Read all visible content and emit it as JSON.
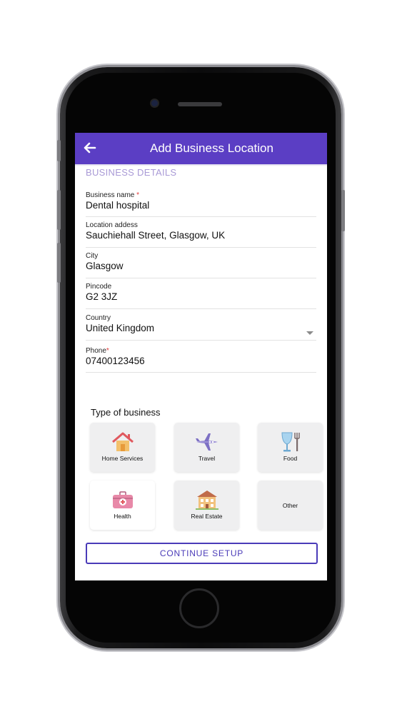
{
  "header": {
    "title": "Add Business Location"
  },
  "section": {
    "title": "BUSINESS DETAILS"
  },
  "fields": {
    "business_name": {
      "label": "Business name",
      "required": "*",
      "value": "Dental hospital"
    },
    "location": {
      "label": "Location addess",
      "value": "Sauchiehall Street, Glasgow, UK"
    },
    "city": {
      "label": "City",
      "value": "Glasgow"
    },
    "pincode": {
      "label": "Pincode",
      "value": "G2 3JZ"
    },
    "country": {
      "label": "Country",
      "value": "United Kingdom"
    },
    "phone": {
      "label": "Phone",
      "required": "*",
      "value": "07400123456"
    }
  },
  "business_types": {
    "title": "Type of business",
    "items": [
      {
        "label": "Home Services",
        "icon": "house-icon"
      },
      {
        "label": "Travel",
        "icon": "airplane-icon"
      },
      {
        "label": "Food",
        "icon": "glass-fork-icon"
      },
      {
        "label": "Health",
        "icon": "medical-kit-icon"
      },
      {
        "label": "Real Estate",
        "icon": "building-icon"
      },
      {
        "label": "Other",
        "icon": ""
      }
    ]
  },
  "actions": {
    "continue": "CONTINUE SETUP"
  },
  "colors": {
    "primary": "#5b3ec4",
    "section": "#a99ad6",
    "required": "#e23b3b",
    "button_border": "#4a3bb8"
  }
}
